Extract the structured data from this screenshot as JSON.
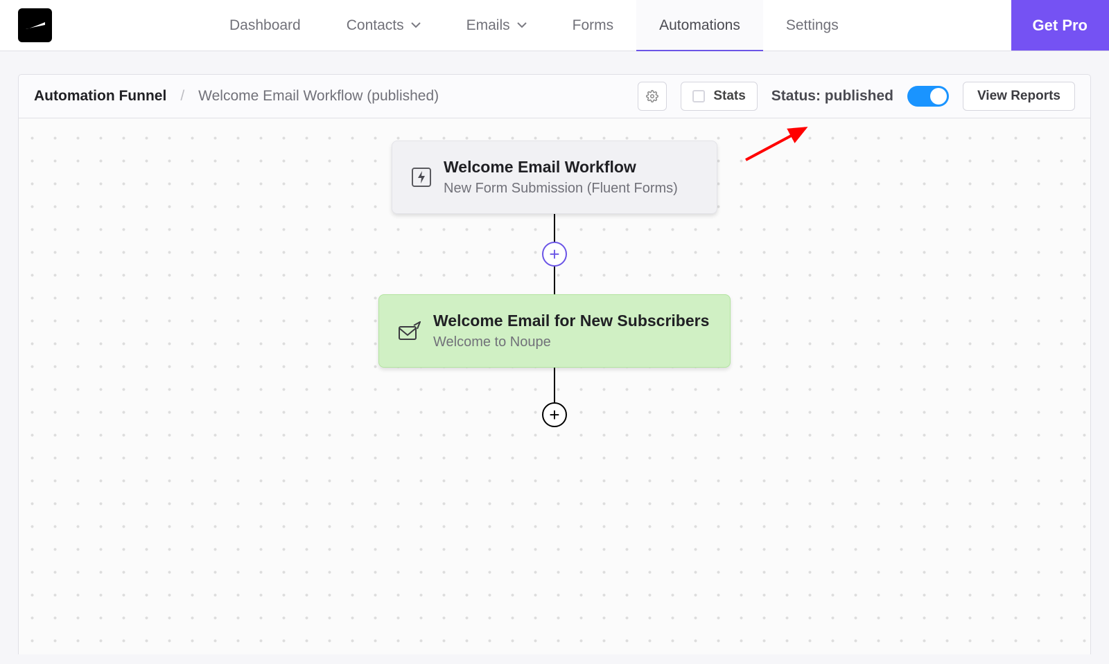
{
  "nav": {
    "dashboard": "Dashboard",
    "contacts": "Contacts",
    "emails": "Emails",
    "forms": "Forms",
    "automations": "Automations",
    "settings": "Settings",
    "get_pro": "Get Pro"
  },
  "breadcrumb": {
    "root": "Automation Funnel",
    "separator": "/",
    "name": "Welcome Email Workflow (published)"
  },
  "toolbar": {
    "stats_label": "Stats",
    "status_label": "Status: published",
    "view_reports_label": "View Reports",
    "status_on": true
  },
  "flow": {
    "trigger": {
      "title": "Welcome Email Workflow",
      "subtitle": "New Form Submission (Fluent Forms)"
    },
    "action": {
      "title": "Welcome Email for New Subscribers",
      "subtitle": "Welcome to Noupe"
    }
  },
  "colors": {
    "accent": "#6b55e6",
    "toggle_on": "#1a94ff",
    "action_bg": "#d0f0c4"
  }
}
